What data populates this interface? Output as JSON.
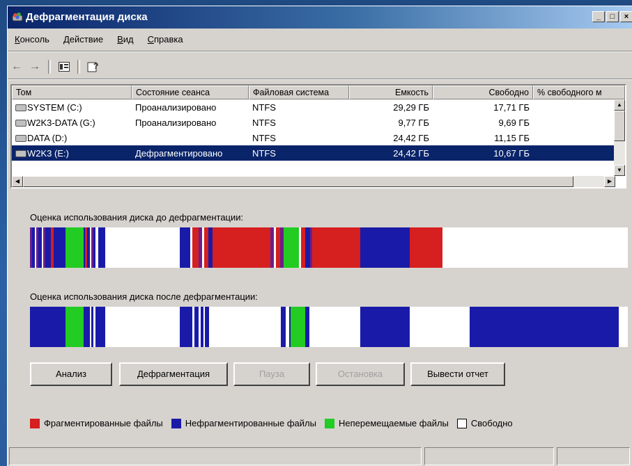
{
  "window": {
    "title": "Дефрагментация диска",
    "controls": [
      "_",
      "□",
      "×"
    ]
  },
  "menu": [
    "Консоль",
    "Действие",
    "Вид",
    "Справка"
  ],
  "toolbar": {
    "back": "←",
    "forward": "→",
    "view": "▣",
    "help": "?"
  },
  "table": {
    "columns": [
      "Том",
      "Состояние сеанса",
      "Файловая система",
      "Емкость",
      "Свободно",
      "% свободного м"
    ],
    "rows": [
      {
        "volume": "SYSTEM (C:)",
        "status": "Проанализировано",
        "fs": "NTFS",
        "capacity": "29,29 ГБ",
        "free": "17,71 ГБ",
        "selected": false
      },
      {
        "volume": "W2K3-DATA (G:)",
        "status": "Проанализировано",
        "fs": "NTFS",
        "capacity": "9,77 ГБ",
        "free": "9,69 ГБ",
        "selected": false
      },
      {
        "volume": "DATA (D:)",
        "status": "",
        "fs": "NTFS",
        "capacity": "24,42 ГБ",
        "free": "11,15 ГБ",
        "selected": false
      },
      {
        "volume": "W2K3 (E:)",
        "status": "Дефрагментировано",
        "fs": "NTFS",
        "capacity": "24,42 ГБ",
        "free": "10,67 ГБ",
        "selected": true
      }
    ]
  },
  "before": {
    "label": "Оценка использования диска до дефрагментации:",
    "segments": [
      [
        "#6a1f8a",
        0.0,
        0.004
      ],
      [
        "#1a1aa8",
        0.004,
        0.008
      ],
      [
        "#ffffff",
        0.008,
        0.01
      ],
      [
        "#6a1f8a",
        0.01,
        0.014
      ],
      [
        "#1a1aa8",
        0.014,
        0.02
      ],
      [
        "#ffffff",
        0.02,
        0.022
      ],
      [
        "#6a1f8a",
        0.022,
        0.026
      ],
      [
        "#1a1aa8",
        0.026,
        0.035
      ],
      [
        "#d61f1f",
        0.035,
        0.04
      ],
      [
        "#1a1aa8",
        0.04,
        0.06
      ],
      [
        "#22cc22",
        0.06,
        0.09
      ],
      [
        "#1a1aa8",
        0.09,
        0.092
      ],
      [
        "#d61f1f",
        0.092,
        0.096
      ],
      [
        "#1a1aa8",
        0.096,
        0.1
      ],
      [
        "#ffffff",
        0.1,
        0.102
      ],
      [
        "#6a1f8a",
        0.102,
        0.106
      ],
      [
        "#1a1aa8",
        0.106,
        0.11
      ],
      [
        "#ffffff",
        0.11,
        0.114
      ],
      [
        "#1a1aa8",
        0.114,
        0.126
      ],
      [
        "#1a1aa8",
        0.25,
        0.268
      ],
      [
        "#ffffff",
        0.268,
        0.272
      ],
      [
        "#d61f1f",
        0.272,
        0.282
      ],
      [
        "#6a1f8a",
        0.282,
        0.288
      ],
      [
        "#ffffff",
        0.288,
        0.291
      ],
      [
        "#d61f1f",
        0.291,
        0.298
      ],
      [
        "#1a1aa8",
        0.298,
        0.305
      ],
      [
        "#d61f1f",
        0.305,
        0.402
      ],
      [
        "#6a1f8a",
        0.402,
        0.408
      ],
      [
        "#ffffff",
        0.408,
        0.412
      ],
      [
        "#d61f1f",
        0.412,
        0.418
      ],
      [
        "#6a1f8a",
        0.418,
        0.424
      ],
      [
        "#22cc22",
        0.424,
        0.45
      ],
      [
        "#ffffff",
        0.45,
        0.453
      ],
      [
        "#d61f1f",
        0.453,
        0.46
      ],
      [
        "#1a1aa8",
        0.46,
        0.468
      ],
      [
        "#6a1f8a",
        0.468,
        0.472
      ],
      [
        "#d61f1f",
        0.472,
        0.552
      ],
      [
        "#1a1aa8",
        0.552,
        0.635
      ],
      [
        "#d61f1f",
        0.635,
        0.69
      ]
    ]
  },
  "after": {
    "label": "Оценка использования диска после дефрагментации:",
    "segments": [
      [
        "#1a1aa8",
        0.0,
        0.06
      ],
      [
        "#22cc22",
        0.06,
        0.09
      ],
      [
        "#1a1aa8",
        0.09,
        0.1
      ],
      [
        "#ffffff",
        0.1,
        0.102
      ],
      [
        "#1a1aa8",
        0.102,
        0.106
      ],
      [
        "#ffffff",
        0.106,
        0.11
      ],
      [
        "#1a1aa8",
        0.11,
        0.126
      ],
      [
        "#1a1aa8",
        0.25,
        0.272
      ],
      [
        "#ffffff",
        0.272,
        0.275
      ],
      [
        "#1a1aa8",
        0.275,
        0.282
      ],
      [
        "#ffffff",
        0.282,
        0.286
      ],
      [
        "#1a1aa8",
        0.286,
        0.29
      ],
      [
        "#ffffff",
        0.29,
        0.293
      ],
      [
        "#1a1aa8",
        0.293,
        0.3
      ],
      [
        "#1a1aa8",
        0.42,
        0.428
      ],
      [
        "#ffffff",
        0.428,
        0.433
      ],
      [
        "#1a1aa8",
        0.433,
        0.436
      ],
      [
        "#22cc22",
        0.436,
        0.46
      ],
      [
        "#1a1aa8",
        0.46,
        0.467
      ],
      [
        "#1a1aa8",
        0.552,
        0.635
      ],
      [
        "#1a1aa8",
        0.735,
        0.985
      ]
    ]
  },
  "buttons": [
    {
      "label": "Анализ",
      "enabled": true
    },
    {
      "label": "Дефрагментация",
      "enabled": true
    },
    {
      "label": "Пауза",
      "enabled": false
    },
    {
      "label": "Остановка",
      "enabled": false
    },
    {
      "label": "Вывести отчет",
      "enabled": true
    }
  ],
  "legend": [
    {
      "label": "Фрагментированные файлы",
      "color": "#d61f1f"
    },
    {
      "label": "Нефрагментированные файлы",
      "color": "#1a1aa8"
    },
    {
      "label": "Неперемещаемые файлы",
      "color": "#22cc22"
    },
    {
      "label": "Свободно",
      "color": "#ffffff"
    }
  ]
}
